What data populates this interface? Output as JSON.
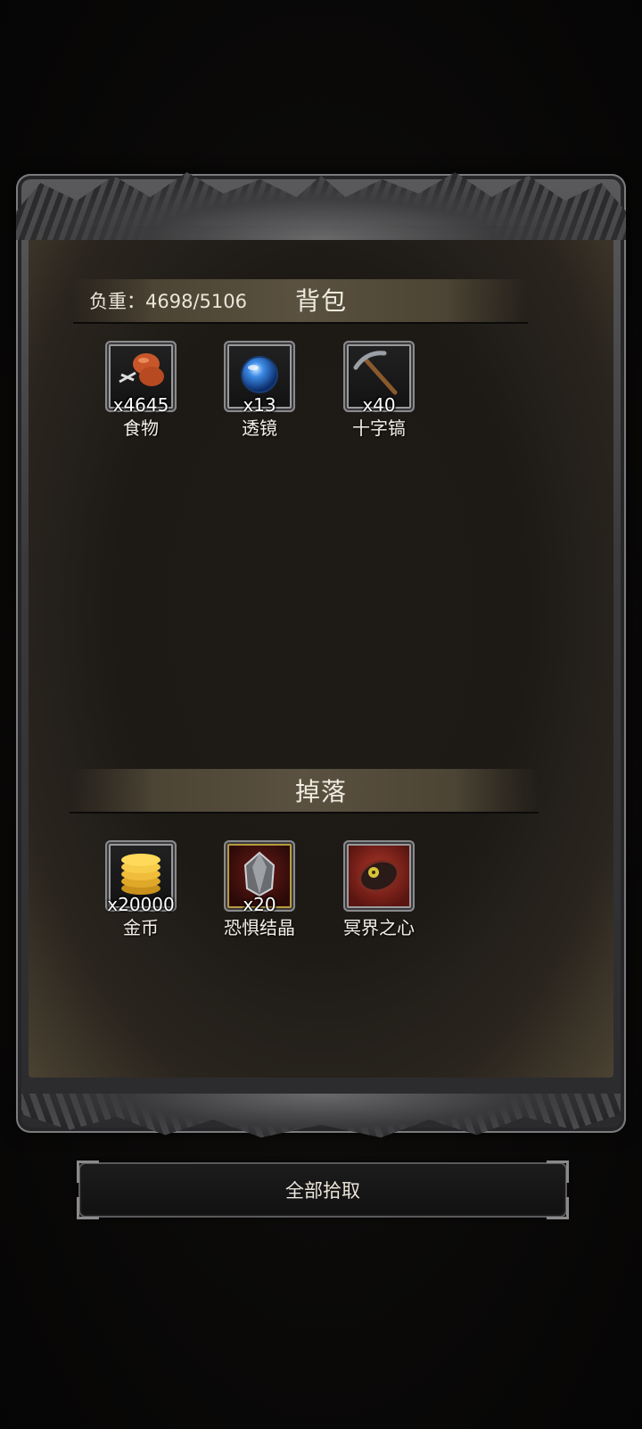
{
  "inventory": {
    "weight_label": "负重：4698/5106",
    "title": "背包",
    "items": [
      {
        "name": "食物",
        "count": "x4645",
        "icon": "food-drumstick-icon"
      },
      {
        "name": "透镜",
        "count": "x13",
        "icon": "blue-lens-orb-icon"
      },
      {
        "name": "十字镐",
        "count": "x40",
        "icon": "pickaxe-icon"
      }
    ]
  },
  "drops": {
    "title": "掉落",
    "items": [
      {
        "name": "金币",
        "count": "x20000",
        "icon": "gold-coins-icon"
      },
      {
        "name": "恐惧结晶",
        "count": "x20",
        "icon": "fear-crystal-icon"
      },
      {
        "name": "冥界之心",
        "count": "",
        "icon": "underworld-heart-icon"
      }
    ]
  },
  "actions": {
    "pickup_all": "全部拾取"
  }
}
